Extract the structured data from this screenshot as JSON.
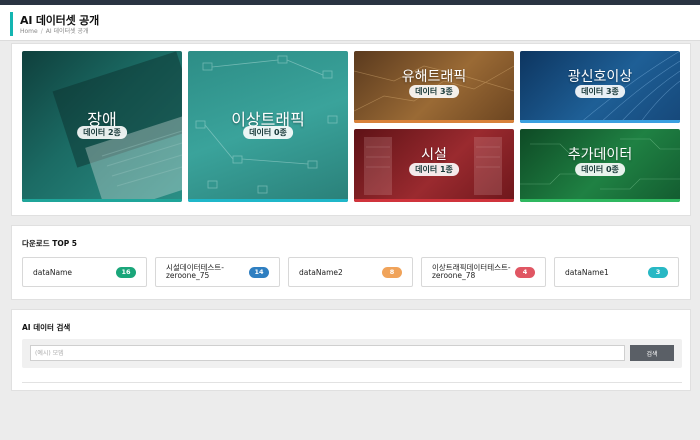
{
  "header": {
    "title": "AI 데이터셋 공개",
    "breadcrumb_home": "Home",
    "breadcrumb_sep": "/",
    "breadcrumb_current": "AI 데이터셋 공개"
  },
  "categories": [
    {
      "label": "장애",
      "badge": "데이터 2종",
      "color": "#1f6f6a"
    },
    {
      "label": "이상트래픽",
      "badge": "데이터 0종",
      "color": "#2a8c86"
    },
    {
      "label": "유해트래픽",
      "badge": "데이터 3종",
      "color": "#8a5a2a"
    },
    {
      "label": "광신호이상",
      "badge": "데이터 3종",
      "color": "#1d5a8a"
    },
    {
      "label": "시설",
      "badge": "데이터 1종",
      "color": "#8a1f25"
    },
    {
      "label": "추가데이터",
      "badge": "데이터 0종",
      "color": "#1e7a3c"
    }
  ],
  "download_top5": {
    "title": "다운로드 TOP 5",
    "items": [
      {
        "name": "dataName",
        "count": "16",
        "color": "#1aa67a"
      },
      {
        "name": "시설데이터테스트-zeroone_75",
        "count": "14",
        "color": "#2f7fc1"
      },
      {
        "name": "dataName2",
        "count": "8",
        "color": "#f0a35a"
      },
      {
        "name": "이상트래픽데이터테스트-zeroone_78",
        "count": "4",
        "color": "#e05663"
      },
      {
        "name": "dataName1",
        "count": "3",
        "color": "#28b8c4"
      }
    ]
  },
  "search": {
    "title": "AI 데이터 검색",
    "placeholder": "(예시) 모뎀",
    "button_label": "검색"
  }
}
